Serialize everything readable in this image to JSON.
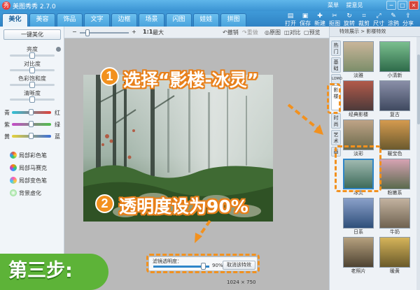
{
  "window": {
    "title": "美图秀秀 2.7.0",
    "links": [
      "菜单",
      "提意见"
    ],
    "buttons": [
      "−",
      "□",
      "×"
    ]
  },
  "tabs": [
    "美化",
    "美容",
    "饰品",
    "文字",
    "边框",
    "场景",
    "闪图",
    "娃娃",
    "拼图"
  ],
  "active_tab": "美化",
  "toolbar": [
    {
      "label": "打开",
      "icon": "folder-icon"
    },
    {
      "label": "保存",
      "icon": "save-icon"
    },
    {
      "label": "新建",
      "icon": "new-icon"
    },
    {
      "label": "抠图",
      "icon": "cutout-icon"
    },
    {
      "label": "旋转",
      "icon": "rotate-icon"
    },
    {
      "label": "裁剪",
      "icon": "crop-icon"
    },
    {
      "label": "尺寸",
      "icon": "resize-icon"
    },
    {
      "label": "涂鸦",
      "icon": "doodle-icon"
    },
    {
      "label": "分享",
      "icon": "share-icon"
    }
  ],
  "left_panel": {
    "onekey_label": "一键美化",
    "adjustments": [
      {
        "label": "亮度",
        "level": 0.5
      },
      {
        "label": "对比度",
        "level": 0.5
      },
      {
        "label": "色彩饱和度",
        "level": 0.5
      },
      {
        "label": "清晰度",
        "level": 0.5
      }
    ],
    "color_balance": [
      {
        "left": "青",
        "right": "红",
        "level": 0.5
      },
      {
        "left": "紫",
        "right": "绿",
        "level": 0.5
      },
      {
        "left": "黄",
        "right": "蓝",
        "level": 0.5
      }
    ],
    "brushes": [
      "局部彩色笔",
      "局部马赛克",
      "局部变色笔",
      "背景虚化"
    ]
  },
  "canvas_toolbar": {
    "zoom_minus": "−",
    "zoom_plus": "+",
    "ratio": "1:1",
    "maximize": "最大",
    "undo": "撤销",
    "redo": "重做",
    "original": "原图",
    "compare": "对比",
    "preview": "预览"
  },
  "image_size": "1024 × 750",
  "opacity_panel": {
    "label": "滤镜透明度：",
    "value_text": "90%",
    "level": 0.9,
    "cancel_label": "取消该特效"
  },
  "right_panel": {
    "header": "特效展示 > 影楼特效",
    "vertical_tabs": [
      "热门",
      "基础",
      "LOMO",
      "影楼",
      "时尚",
      "艺术",
      "画"
    ],
    "active_vertical_tab": "影楼",
    "effects": [
      "淡雅",
      "小清新",
      "经典影楼",
      "复古",
      "淡彩",
      "暖宝色",
      "冰灵",
      "粉嫩系",
      "日系",
      "牛奶",
      "老照片",
      "暖黄"
    ],
    "selected_effect": "冰灵"
  },
  "annotations": {
    "step1_number": "1",
    "step1_text": "选择“影楼-冰灵”",
    "step2_number": "2",
    "step2_text": "透明度设为90%",
    "step_banner": "第三步:"
  },
  "colors": {
    "accent_orange": "#f2911e",
    "banner_green": "#5db338",
    "titlebar_blue": "#3a93d3"
  }
}
